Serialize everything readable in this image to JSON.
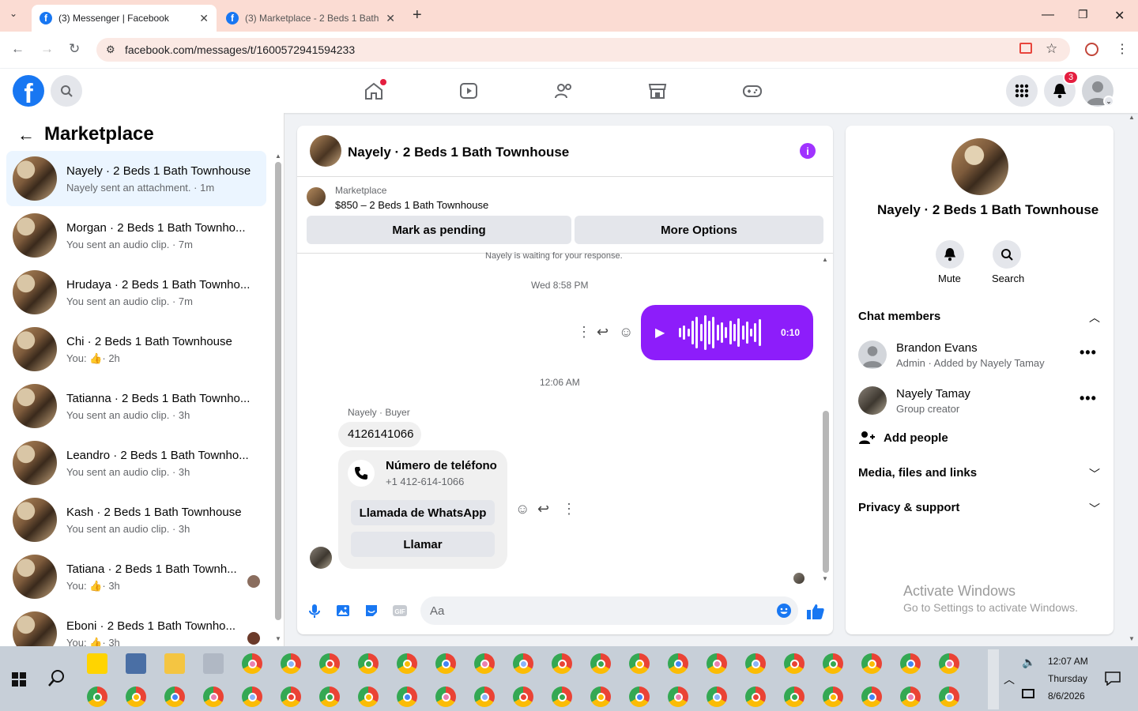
{
  "browser": {
    "tabs": [
      {
        "label": "(3) Messenger | Facebook"
      },
      {
        "label": "(3) Marketplace - 2 Beds 1 Bath"
      }
    ],
    "url": "facebook.com/messages/t/1600572941594233",
    "new_tab": "+"
  },
  "fb_header": {
    "logo": "f",
    "notif_count": "3"
  },
  "sidebar": {
    "title": "Marketplace",
    "conversations": [
      {
        "title": "Nayely · 2 Beds 1 Bath Townhouse",
        "sub": "Nayely sent an attachment. · 1m"
      },
      {
        "title": "Morgan · 2 Beds 1 Bath Townho...",
        "sub": "You sent an audio clip. · 7m"
      },
      {
        "title": "Hrudaya · 2 Beds 1 Bath Townho...",
        "sub": "You sent an audio clip. · 7m"
      },
      {
        "title": "Chi · 2 Beds 1 Bath Townhouse",
        "sub_prefix": "You:",
        "sub_time": "· 2h"
      },
      {
        "title": "Tatianna · 2 Beds 1 Bath Townho...",
        "sub": "You sent an audio clip. · 3h"
      },
      {
        "title": "Leandro · 2 Beds 1 Bath Townho...",
        "sub": "You sent an audio clip. · 3h"
      },
      {
        "title": "Kash · 2 Beds 1 Bath Townhouse",
        "sub": "You sent an audio clip. · 3h"
      },
      {
        "title": "Tatiana · 2 Beds 1 Bath Townh...",
        "sub_prefix": "You:",
        "sub_time": "· 3h"
      },
      {
        "title": "Eboni · 2 Beds 1 Bath Townho...",
        "sub_prefix": "You:",
        "sub_time": "· 3h"
      }
    ]
  },
  "chat": {
    "title": "Nayely · 2 Beds 1 Bath Townhouse",
    "listing_label": "Marketplace",
    "listing_title": "$850 – 2 Beds 1 Bath Townhouse",
    "btn_pending": "Mark as pending",
    "btn_more": "More Options",
    "waiting": "Nayely is waiting for your response.",
    "stamp1": "Wed 8:58 PM",
    "voice_duration": "0:10",
    "stamp2": "12:06 AM",
    "sender_label": "Nayely · Buyer",
    "phone_msg": "4126141066",
    "card_title": "Número de teléfono",
    "card_phone": "+1 412-614-1066",
    "btn_whatsapp": "Llamada de WhatsApp",
    "btn_call": "Llamar",
    "input_placeholder": "Aa"
  },
  "info_panel": {
    "name": "Nayely · 2 Beds 1 Bath Townhouse",
    "mute": "Mute",
    "search": "Search",
    "chat_members": "Chat members",
    "members": [
      {
        "name": "Brandon Evans",
        "role": "Admin · Added by Nayely Tamay"
      },
      {
        "name": "Nayely Tamay",
        "role": "Group creator"
      }
    ],
    "add_people": "Add people",
    "media": "Media, files and links",
    "privacy": "Privacy & support",
    "activate_title": "Activate Windows",
    "activate_sub": "Go to Settings to activate Windows."
  },
  "taskbar": {
    "time": "12:07 AM",
    "day": "Thursday",
    "date": "8/6/2026"
  },
  "colors": {
    "fb_blue": "#1877f2",
    "messenger_purple": "#8d1dfa",
    "selected_row": "#ebf5ff"
  }
}
